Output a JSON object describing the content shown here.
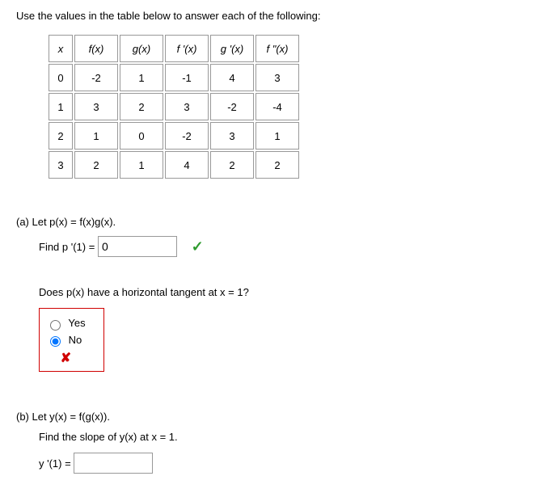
{
  "instruction": "Use the values in the table below to answer each of the following:",
  "table": {
    "headers": [
      "x",
      "f(x)",
      "g(x)",
      "f '(x)",
      "g '(x)",
      "f \"(x)"
    ],
    "rows": [
      [
        "0",
        "-2",
        "1",
        "-1",
        "4",
        "3"
      ],
      [
        "1",
        "3",
        "2",
        "3",
        "-2",
        "-4"
      ],
      [
        "2",
        "1",
        "0",
        "-2",
        "3",
        "1"
      ],
      [
        "3",
        "2",
        "1",
        "4",
        "2",
        "2"
      ]
    ]
  },
  "partA": {
    "label": "(a) Let p(x) = f(x)g(x).",
    "findLine": "Find p '(1) = ",
    "answer": "0",
    "tangentQ": "Does p(x) have a horizontal tangent at x = 1?",
    "optYes": "Yes",
    "optNo": "No"
  },
  "partB": {
    "label": "(b) Let y(x) = f(g(x)).",
    "slopeLine": "Find the slope of y(x) at x = 1.",
    "yprime": "y '(1) = ",
    "answer": ""
  }
}
